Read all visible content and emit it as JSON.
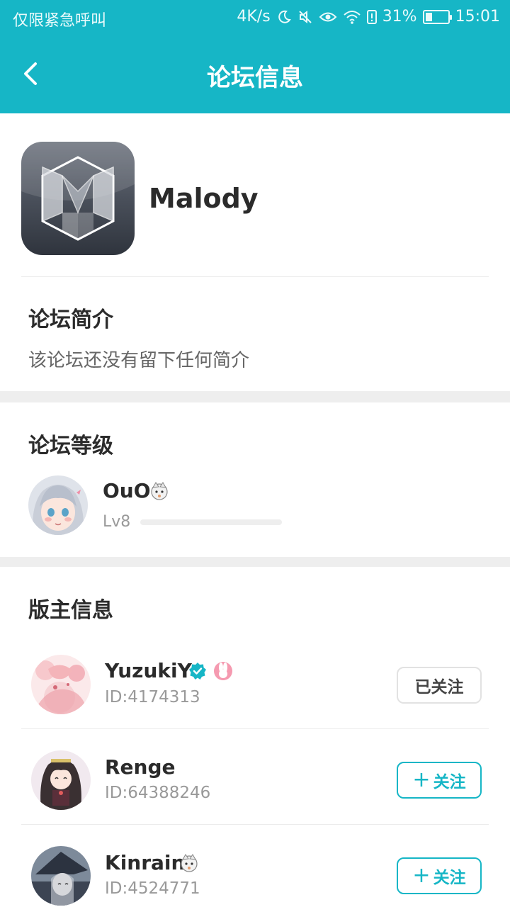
{
  "status": {
    "carrier": "仅限紧急呼叫",
    "speed": "4K/s",
    "battery": "31%",
    "battery_level": 0.31,
    "time": "15:01"
  },
  "nav": {
    "title": "论坛信息"
  },
  "forum": {
    "name": "Malody"
  },
  "intro": {
    "title": "论坛简介",
    "text": "该论坛还没有留下任何简介"
  },
  "level": {
    "title": "论坛等级",
    "user": "OuO",
    "level": "Lv8",
    "progress": 0.0
  },
  "moderators": {
    "title": "版主信息",
    "items": [
      {
        "name": "YuzukiY",
        "id": "ID:4174313",
        "button": "已关注"
      },
      {
        "name": "Renge",
        "id": "ID:64388246",
        "button": "关注"
      },
      {
        "name": "Kinrain",
        "id": "ID:4524771",
        "button": "关注"
      }
    ]
  },
  "colors": {
    "accent": "#16b6c6"
  }
}
